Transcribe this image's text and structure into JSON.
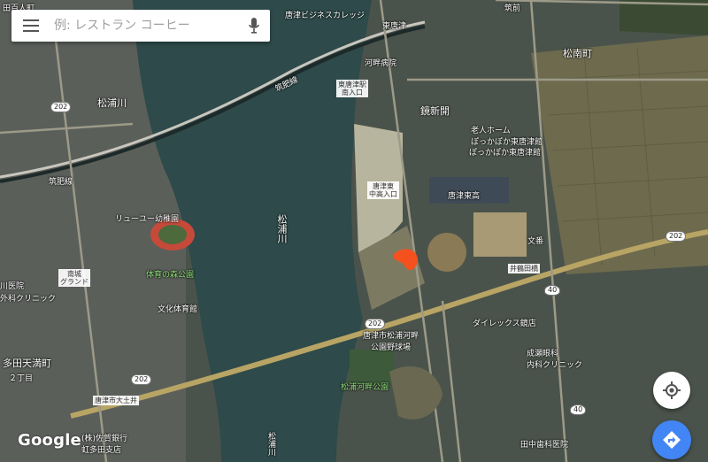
{
  "search": {
    "placeholder": "例: レストラン コーヒー"
  },
  "map": {
    "labels": {
      "karatsu_business_college": "唐津ビジネスカレッジ",
      "higashi_karatsu_station": "東唐津",
      "karatsu_station_label_top": "筑前",
      "matsunan_cho": "松南町",
      "kahan_hospital": "河畔病院",
      "higashi_karatsu_eki_minami": "東唐津駅\n南入口",
      "kyoshinden": "鏡新開",
      "chikuhi_line_top": "筑肥線",
      "chikuhi_line_left": "筑肥線",
      "matsuura_river_top": "松浦川",
      "matsuura_river_mid": "松浦川",
      "matsuura_river_bottom": "松浦川",
      "old_people_home": "老人ホーム\nぽっかぽか東唐津館",
      "pokkapoka": "ぽっかぽか東唐津館",
      "karatsu_higashi_kou": "唐津東高",
      "higashi_karatsu_chugaku": "唐津東\n中高入口",
      "ryu_yu_yochien": "リューユー幼稚園",
      "tairyoku_no_mori": "体育の森公園",
      "bunka_taiikukan": "文化体育館",
      "minami_grand": "南城\nグランド",
      "kurinikku_left": "外科クリニック",
      "iin_left": "川医院",
      "taki_machi": "多田天満町",
      "nichome": "２丁目",
      "bun_ban": "文番",
      "iga_tanaka": "井鶴田橋",
      "dairekkusu": "ダイレックス鏡店",
      "kousei_matsuura_kahan": "唐津市松浦河畔\n公園野球場",
      "naruse_eye": "成瀬眼科\n内科クリニック",
      "matsuura_kahan_park": "松浦河畔公園",
      "karatsu_shi_oishi": "唐津市大土井",
      "tanaka_dental": "田中歯科医院",
      "bank_kaga": "(株)佐賀銀行\n虹多田支店",
      "shibata_top_left": "田百人町",
      "route_202_a": "202",
      "route_202_b": "202",
      "route_202_c": "202",
      "route_202_d": "202",
      "route_40_a": "40",
      "route_40_b": "40"
    },
    "marker_color": "#f4511e"
  },
  "controls": {
    "google_logo": "Google",
    "my_location_icon": "my-location-icon",
    "directions_icon": "directions-icon"
  }
}
